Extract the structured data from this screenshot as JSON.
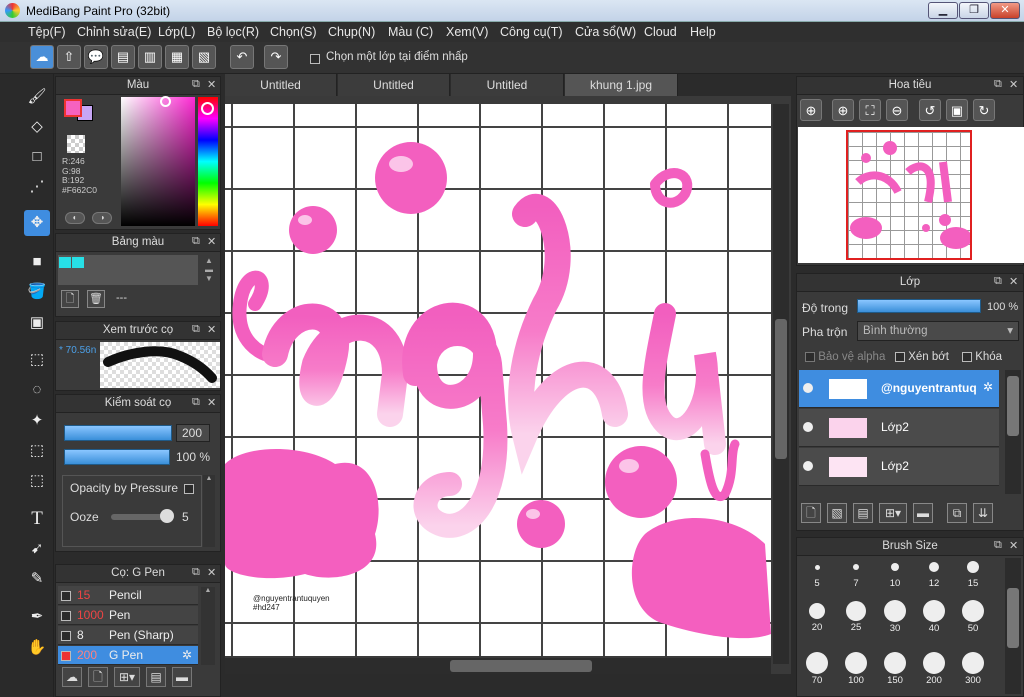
{
  "window": {
    "title": "MediBang Paint Pro (32bit)",
    "min": "▁",
    "max": "❐",
    "close": "✕"
  },
  "menu": [
    "Tệp(F)",
    "Chỉnh sửa(E)",
    "Lớp(L)",
    "Bộ lọc(R)",
    "Chọn(S)",
    "Chụp(N)",
    "Màu (C)",
    "Xem(V)",
    "Công cụ(T)",
    "Cửa sổ(W)",
    "Cloud",
    "Help"
  ],
  "toolbar": {
    "select_layer_label": "Chọn một lớp tại điểm nhấp"
  },
  "color_panel": {
    "title": "Màu",
    "r": "R:246",
    "g": "G:98",
    "b": "B:192",
    "hex": "#F662C0",
    "primary": "#F662C0"
  },
  "palette_panel": {
    "title": "Bảng màu",
    "swatch": "#27e0e6",
    "dash": "---"
  },
  "brush_preview": {
    "title": "Xem trước cọ",
    "size": "* 70.56n"
  },
  "brush_control": {
    "title": "Kiểm soát cọ",
    "size_value": "200",
    "opacity_value": "100 %",
    "opacity_by_pressure": "Opacity by Pressure",
    "ooze_label": "Ooze",
    "ooze_value": "5"
  },
  "brush_list": {
    "title": "Cọ: G Pen",
    "items": [
      {
        "size": "15",
        "name": "Pencil",
        "color": "#e44"
      },
      {
        "size": "1000",
        "name": "Pen",
        "color": "#e44"
      },
      {
        "size": "8",
        "name": "Pen (Sharp)",
        "color": "#ddd"
      },
      {
        "size": "200",
        "name": "G Pen",
        "color": "#ff5a5a"
      }
    ]
  },
  "tabs": [
    "Untitled",
    "Untitled",
    "Untitled",
    "khung 1.jpg"
  ],
  "canvas": {
    "word": "nghỉ",
    "watermark1": "@nguyentrantuquyen",
    "watermark2": "#hd247"
  },
  "navigator": {
    "title": "Hoa tiêu"
  },
  "layer_panel": {
    "title": "Lớp",
    "opacity_label": "Độ trong",
    "opacity_value": "100 %",
    "opacity_level": 1.0,
    "blend_label": "Pha trộn",
    "blend_value": "Bình thường",
    "protect_alpha": "Bảo vệ alpha",
    "clipping": "Xén bớt",
    "lock": "Khóa",
    "layers": [
      {
        "name": "@nguyentrantuq",
        "selected": true
      },
      {
        "name": "Lớp2",
        "selected": false
      },
      {
        "name": "Lớp2",
        "selected": false
      }
    ]
  },
  "brush_size": {
    "title": "Brush Size",
    "sizes": [
      "5",
      "7",
      "10",
      "12",
      "15",
      "20",
      "25",
      "30",
      "40",
      "50",
      "70",
      "100",
      "150",
      "200",
      "300"
    ]
  }
}
